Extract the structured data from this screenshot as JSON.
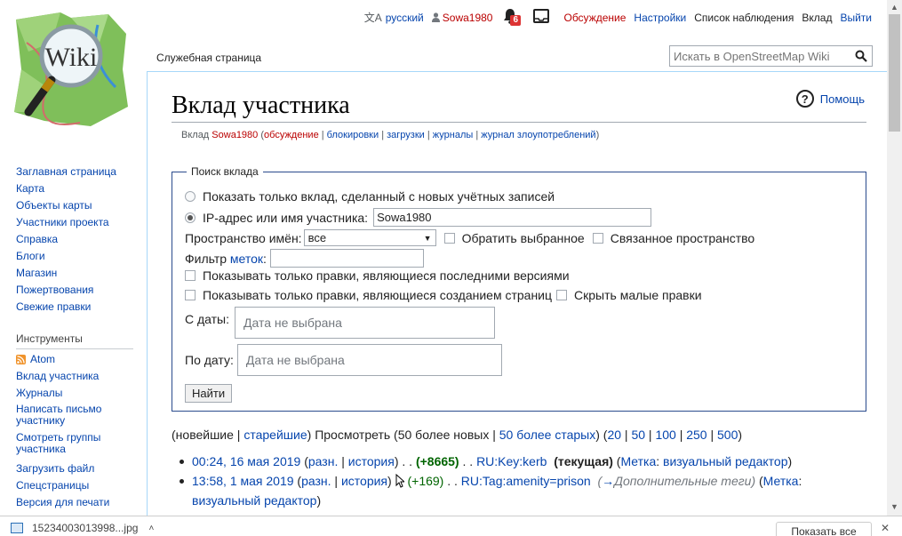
{
  "personal_tools": {
    "language": "русский",
    "username": "Sowa1980",
    "notifications_count": "6",
    "talk": "Обсуждение",
    "preferences": "Настройки",
    "watchlist": "Список наблюдения",
    "contributions": "Вклад",
    "logout": "Выйти"
  },
  "logo": {
    "text": "Wiki"
  },
  "sidebar": {
    "navigation": [
      "Заглавная страница",
      "Карта",
      "Объекты карты",
      "Участники проекта",
      "Справка",
      "Блоги",
      "Магазин",
      "Пожертвования",
      "Свежие правки"
    ],
    "tools_heading": "Инструменты",
    "tools": [
      "Atom",
      "Вклад участника",
      "Журналы",
      "Написать письмо участнику",
      "Смотреть группы участника",
      "Загрузить файл",
      "Спецстраницы",
      "Версия для печати"
    ]
  },
  "tabs": {
    "special": "Служебная страница"
  },
  "search": {
    "placeholder": "Искать в OpenStreetMap Wiki"
  },
  "page": {
    "title": "Вклад участника",
    "help": "Помощь",
    "subtitle": {
      "prefix": "Вклад",
      "user": "Sowa1980",
      "talk": "обсуждение",
      "blocks": "блокировки",
      "uploads": "загрузки",
      "logs": "журналы",
      "abuse_log": "журнал злоупотреблений"
    }
  },
  "form": {
    "legend": "Поиск вклада",
    "radio_newbies": "Показать только вклад, сделанный с новых учётных записей",
    "radio_user": "IP-адрес или имя участника:",
    "user_value": "Sowa1980",
    "namespace_label": "Пространство имён:",
    "namespace_value": "все",
    "invert": "Обратить выбранное",
    "associated": "Связанное пространство",
    "tag_filter_prefix": "Фильтр",
    "tag_filter_link": "меток",
    "tag_filter_suffix": ":",
    "only_latest": "Показывать только правки, являющиеся последними версиями",
    "only_new_pages": "Показывать только правки, являющиеся созданием страниц",
    "hide_minor": "Скрыть малые правки",
    "from_label": "С даты:",
    "from_placeholder": "Дата не выбрана",
    "to_label": "По дату:",
    "to_placeholder": "Дата не выбрана",
    "submit": "Найти"
  },
  "pager": {
    "newest": "новейшие",
    "oldest": "старейшие",
    "view": "Просмотреть",
    "newer50": "50 более новых",
    "older50": "50 более старых",
    "limits": [
      "20",
      "50",
      "100",
      "250",
      "500"
    ]
  },
  "contributions": [
    {
      "date": "00:24, 16 мая 2019",
      "diff": "разн.",
      "hist": "история",
      "size": "(+8665)",
      "page": "RU:Key:kerb",
      "current": "(текущая)",
      "tag_label": "Метка",
      "tag_value": "визуальный редактор"
    },
    {
      "date": "13:58, 1 мая 2019",
      "diff": "разн.",
      "hist": "история",
      "size": "(+169)",
      "page": "RU:Tag:amenity=prison",
      "summary_arrow": "→",
      "summary": "Дополнительные теги",
      "tag_label": "Метка",
      "tag_value": "визуальный редактор"
    }
  ],
  "download_bar": {
    "filename": "15234003013998...jpg",
    "show_all": "Показать все",
    "close": "✕"
  }
}
